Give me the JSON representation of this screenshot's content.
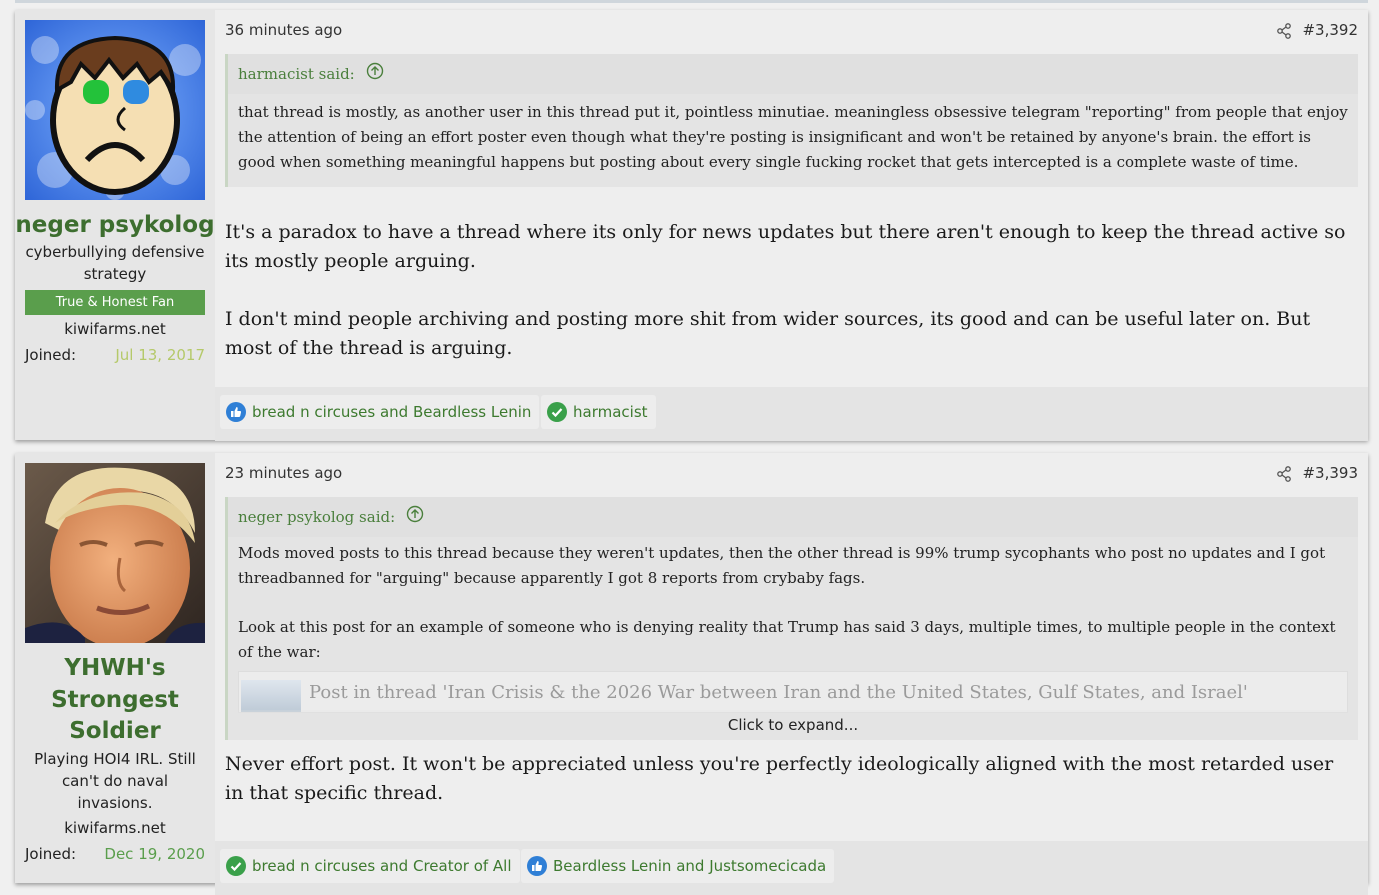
{
  "posts": [
    {
      "author": "neger psykolog",
      "user_title": "cyberbullying defensive strategy",
      "banner": "True & Honest Fan",
      "site": "kiwifarms.net",
      "joined_label": "Joined:",
      "joined_date": "Jul 13, 2017",
      "time": "36 minutes ago",
      "post_number": "#3,392",
      "quote": {
        "author": "harmacist said:",
        "text": "that thread is mostly, as another user in this thread put it, pointless minutiae. meaningless obsessive telegram \"reporting\" from people that enjoy the attention of being an effort poster even though what they're posting is insignificant and won't be retained by anyone's brain. the effort is good when something meaningful happens but posting about every single fucking rocket that gets intercepted is a complete waste of time."
      },
      "paragraphs": [
        "It's a paradox to have a thread where its only for news updates but there aren't enough to keep the thread active so its mostly people arguing.",
        "I don't mind people archiving and posting more shit from wider sources, its good and can be useful later on. But most of the thread is arguing."
      ],
      "reactions": [
        {
          "icon": "thumbs-up-icon",
          "text": "bread n circuses and Beardless Lenin"
        },
        {
          "icon": "checkmark-icon",
          "text": "harmacist"
        }
      ]
    },
    {
      "author": "YHWH's Strongest Soldier",
      "user_title": "Playing HOI4 IRL. Still can't do naval invasions.",
      "site": "kiwifarms.net",
      "joined_label": "Joined:",
      "joined_date": "Dec 19, 2020",
      "time": "23 minutes ago",
      "post_number": "#3,393",
      "quote": {
        "author": "neger psykolog said:",
        "paragraphs": [
          "Mods moved posts to this thread because they weren't updates, then the other thread is 99% trump sycophants who post no updates and I got threadbanned for \"arguing\" because apparently I got 8 reports from crybaby fags.",
          "Look at this post for an example of someone who is denying reality that Trump has said 3 days, multiple times, to multiple people in the context of the war:"
        ],
        "embed_title": "Post in thread 'Iran Crisis & the 2026 War between Iran and the United States, Gulf States, and Israel'",
        "expand_label": "Click to expand..."
      },
      "paragraphs": [
        "Never effort post. It won't be appreciated unless you're perfectly ideologically aligned with the most retarded user in that specific thread."
      ],
      "reactions": [
        {
          "icon": "checkmark-icon",
          "text": "bread n circuses and Creator of All"
        },
        {
          "icon": "thumbs-up-icon",
          "text": "Beardless Lenin and Justsomecicada"
        }
      ]
    }
  ],
  "colors": {
    "username": "#3d6e2f",
    "banner_bg": "#5a9e4c",
    "joined_date_post1": "#b5c96a",
    "joined_date_post2": "#5a9e4c",
    "reaction_text": "#3d7a2f",
    "like_blue": "#2f7fd6",
    "check_green": "#3aa04a"
  }
}
